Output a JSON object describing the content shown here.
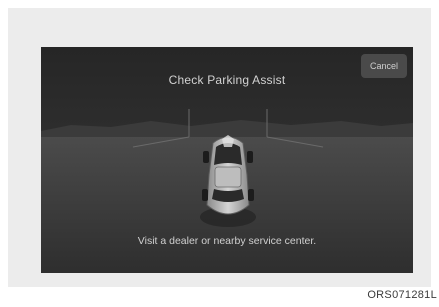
{
  "dialog": {
    "title": "Check Parking Assist",
    "cancel_label": "Cancel",
    "message": "Visit a dealer or nearby service center."
  },
  "figure_code": "ORS071281L",
  "colors": {
    "screen_background": "#2c2c2c",
    "text": "#d2d2d2",
    "button_background": "#4a4a4a"
  },
  "icons": {
    "vehicle": "car-top-view-icon"
  }
}
